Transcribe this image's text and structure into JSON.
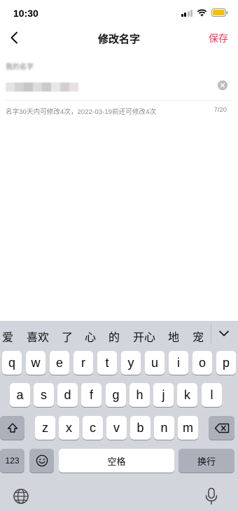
{
  "status_bar": {
    "time": "10:30"
  },
  "nav": {
    "title": "修改名字",
    "save_label": "保存"
  },
  "form": {
    "label": "我的名字",
    "hint": "名字30天内可修改4次，2022-03-19前还可修改4次",
    "counter": "7/20"
  },
  "keyboard": {
    "candidates": [
      "爱",
      "喜欢",
      "了",
      "心",
      "的",
      "开心",
      "地",
      "宠"
    ],
    "rows": [
      [
        "q",
        "w",
        "e",
        "r",
        "t",
        "y",
        "u",
        "i",
        "o",
        "p"
      ],
      [
        "a",
        "s",
        "d",
        "f",
        "g",
        "h",
        "j",
        "k",
        "l"
      ],
      [
        "z",
        "x",
        "c",
        "v",
        "b",
        "n",
        "m"
      ]
    ],
    "numbers_key": "123",
    "space_label": "空格",
    "return_label": "换行"
  },
  "colors": {
    "accent": "#e6375b",
    "keyboard_bg": "#d2d5db",
    "function_key": "#abb0ba"
  }
}
